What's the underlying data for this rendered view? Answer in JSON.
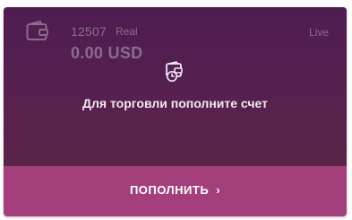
{
  "account": {
    "number": "12507",
    "type": "Real",
    "mode": "Live",
    "balance": "0.00 USD",
    "icon": "wallet-icon"
  },
  "message": {
    "text": "Для торговли пополните счет",
    "icon": "deposit-wallet-icon"
  },
  "action": {
    "label": "ПОПОЛНИТЬ",
    "chevron": "›"
  },
  "colors": {
    "card_bg": "#4f1d52",
    "footer_bg": "#a33f7d",
    "muted_text": "#8a6d8c"
  }
}
